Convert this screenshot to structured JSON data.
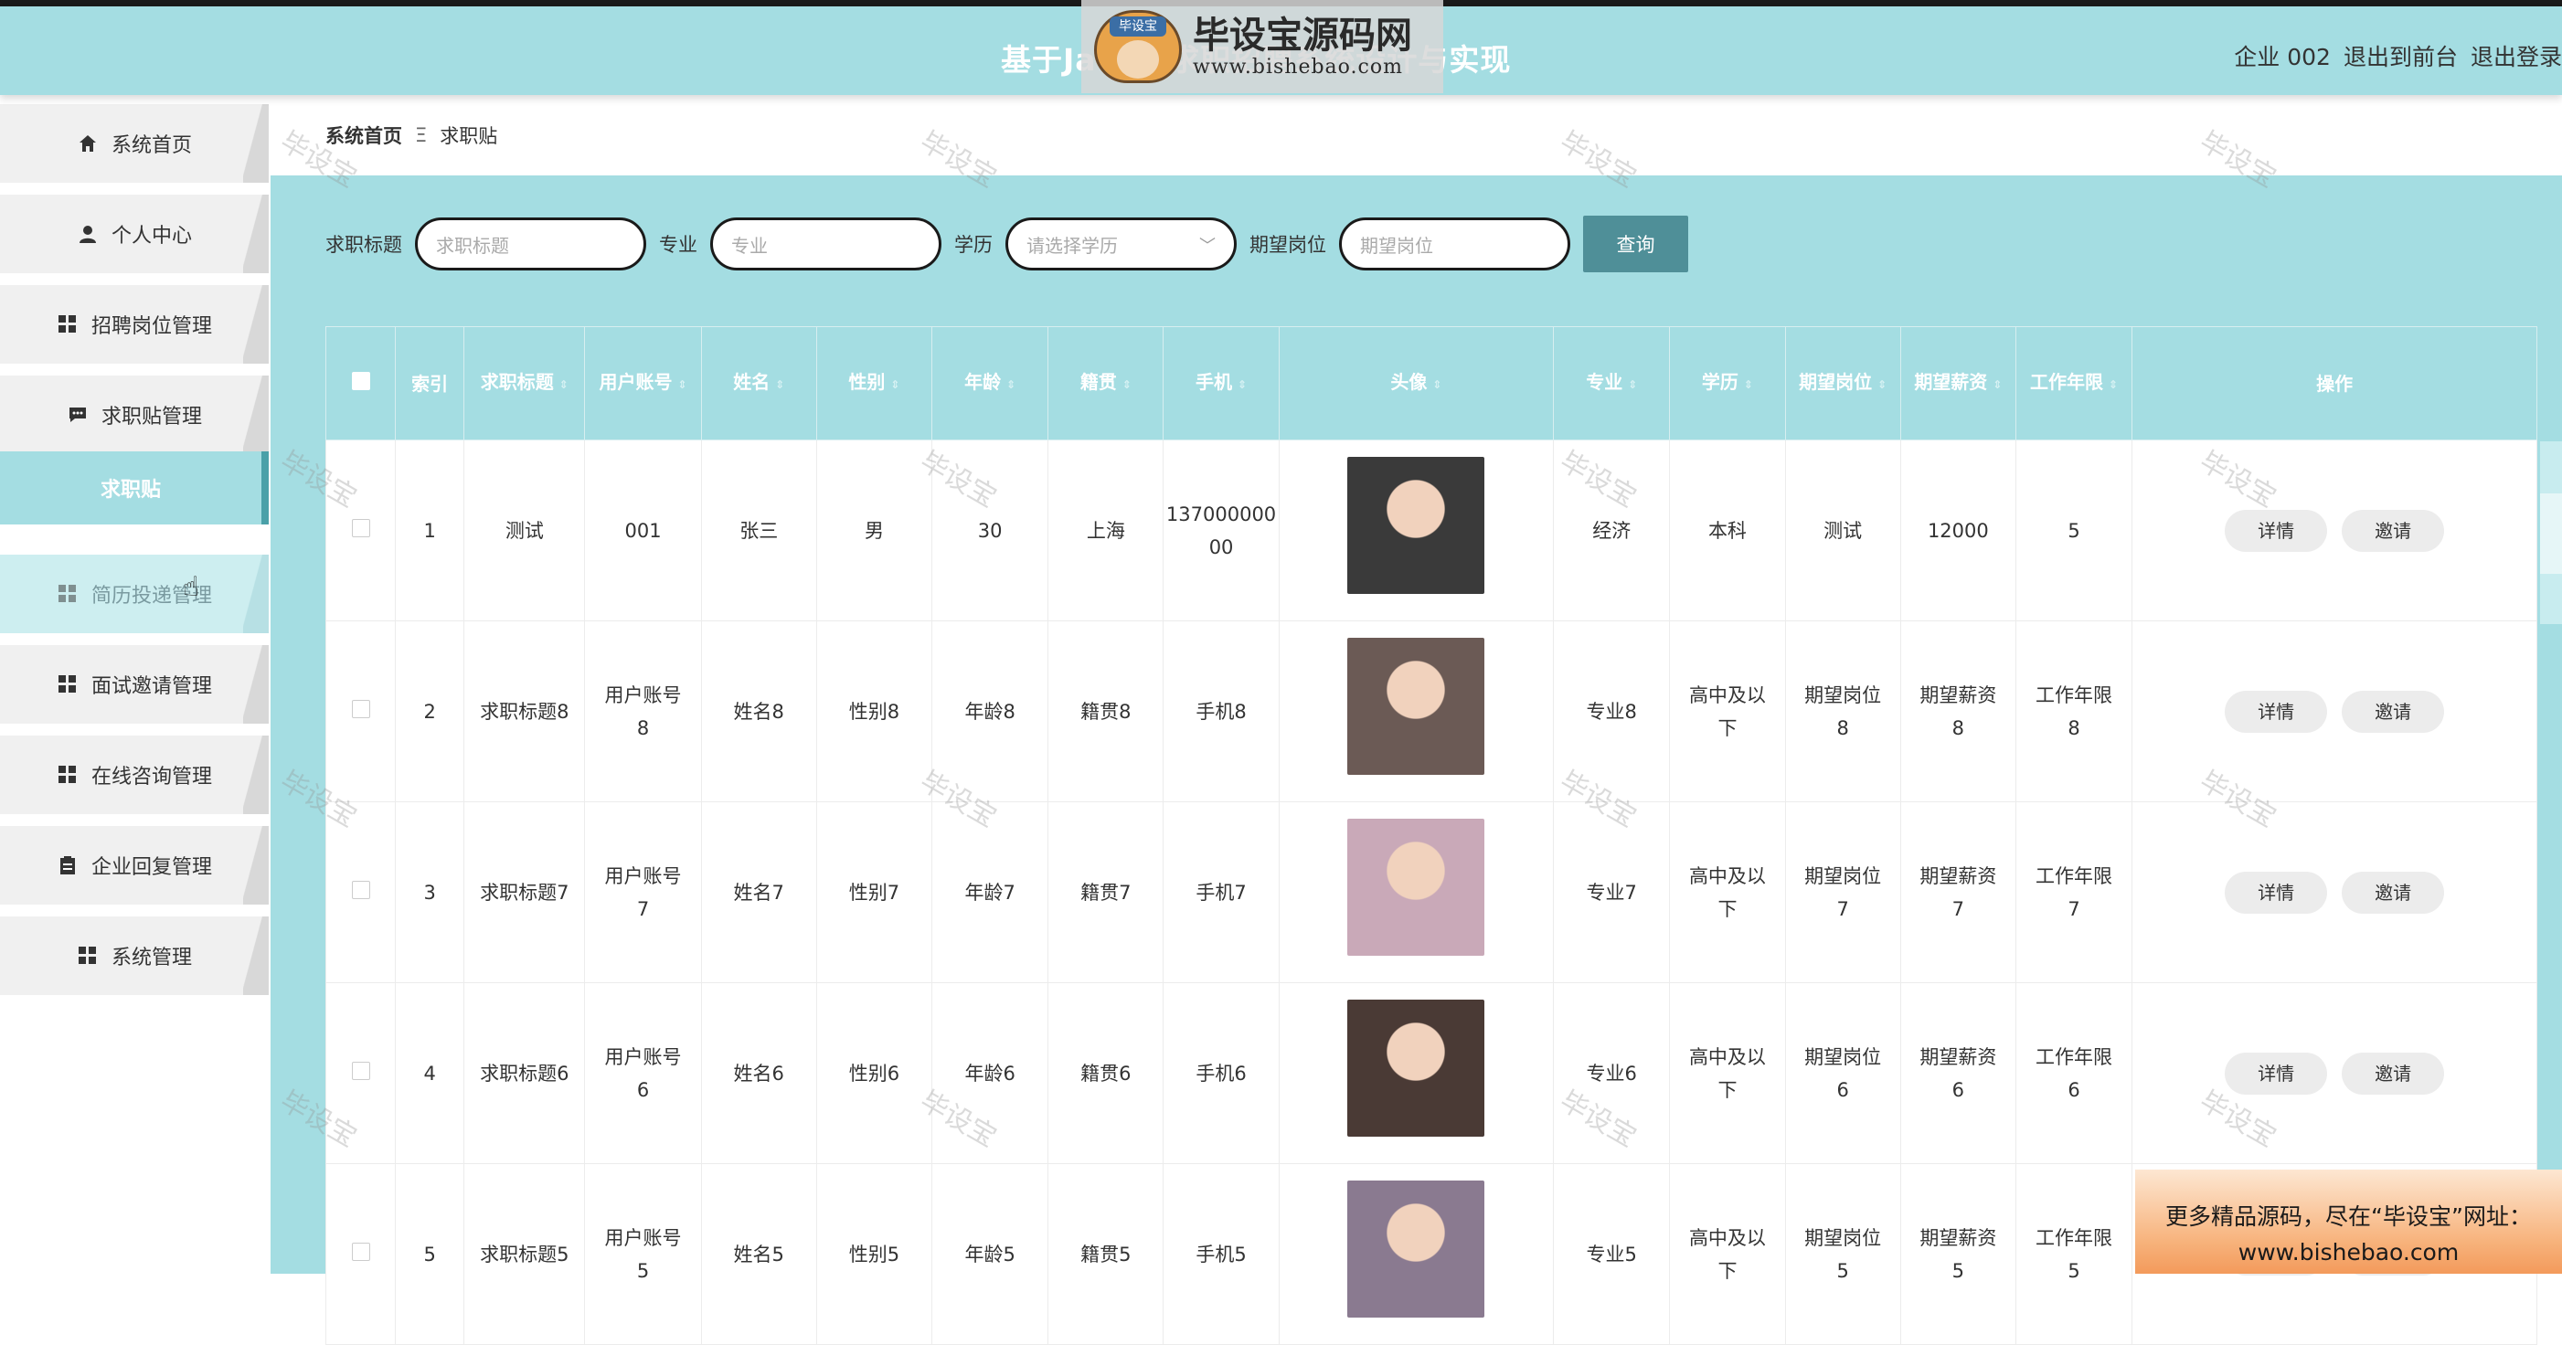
{
  "header": {
    "title": "基于Java的求职招聘系统设计与实现",
    "right": [
      "企业 002",
      "退出到前台",
      "退出登录"
    ]
  },
  "logo": {
    "main": "毕设宝源码网",
    "url": "www.bishebao.com",
    "badge": "毕设宝"
  },
  "sidebar": {
    "items": [
      {
        "label": "系统首页",
        "icon": "home-icon"
      },
      {
        "label": "个人中心",
        "icon": "user-icon"
      },
      {
        "label": "招聘岗位管理",
        "icon": "grid-icon"
      },
      {
        "label": "求职贴管理",
        "icon": "chat-icon"
      },
      {
        "label": "求职贴",
        "icon": ""
      },
      {
        "label": "简历投递管理",
        "icon": "grid-icon"
      },
      {
        "label": "面试邀请管理",
        "icon": "grid-icon"
      },
      {
        "label": "在线咨询管理",
        "icon": "grid-icon"
      },
      {
        "label": "企业回复管理",
        "icon": "clipboard-icon"
      },
      {
        "label": "系统管理",
        "icon": "grid-icon"
      }
    ]
  },
  "breadcrumb": {
    "home": "系统首页",
    "separator": "Ξ",
    "current": "求职贴"
  },
  "search": {
    "fields": [
      {
        "label": "求职标题",
        "placeholder": "求职标题"
      },
      {
        "label": "专业",
        "placeholder": "专业"
      },
      {
        "label": "学历",
        "placeholder": "请选择学历"
      },
      {
        "label": "期望岗位",
        "placeholder": "期望岗位"
      }
    ],
    "button": "查询"
  },
  "table": {
    "columns": [
      "",
      "索引",
      "求职标题",
      "用户账号",
      "姓名",
      "性别",
      "年龄",
      "籍贯",
      "手机",
      "头像",
      "专业",
      "学历",
      "期望岗位",
      "期望薪资",
      "工作年限",
      "操作"
    ],
    "rows": [
      {
        "idx": "1",
        "title": "测试",
        "account": "001",
        "name": "张三",
        "gender": "男",
        "age": "30",
        "origin": "上海",
        "phone": "13700000000",
        "major": "经济",
        "edu": "本科",
        "position": "测试",
        "salary": "12000",
        "years": "5",
        "avatar_color": "#3a3a3a"
      },
      {
        "idx": "2",
        "title": "求职标题8",
        "account": "用户账号8",
        "name": "姓名8",
        "gender": "性别8",
        "age": "年龄8",
        "origin": "籍贯8",
        "phone": "手机8",
        "major": "专业8",
        "edu": "高中及以下",
        "position": "期望岗位8",
        "salary": "期望薪资8",
        "years": "工作年限8",
        "avatar_color": "#6b5a55"
      },
      {
        "idx": "3",
        "title": "求职标题7",
        "account": "用户账号7",
        "name": "姓名7",
        "gender": "性别7",
        "age": "年龄7",
        "origin": "籍贯7",
        "phone": "手机7",
        "major": "专业7",
        "edu": "高中及以下",
        "position": "期望岗位7",
        "salary": "期望薪资7",
        "years": "工作年限7",
        "avatar_color": "#c9a9b8"
      },
      {
        "idx": "4",
        "title": "求职标题6",
        "account": "用户账号6",
        "name": "姓名6",
        "gender": "性别6",
        "age": "年龄6",
        "origin": "籍贯6",
        "phone": "手机6",
        "major": "专业6",
        "edu": "高中及以下",
        "position": "期望岗位6",
        "salary": "期望薪资6",
        "years": "工作年限6",
        "avatar_color": "#4a3a35"
      },
      {
        "idx": "5",
        "title": "求职标题5",
        "account": "用户账号5",
        "name": "姓名5",
        "gender": "性别5",
        "age": "年龄5",
        "origin": "籍贯5",
        "phone": "手机5",
        "major": "专业5",
        "edu": "高中及以下",
        "position": "期望岗位5",
        "salary": "期望薪资5",
        "years": "工作年限5",
        "avatar_color": "#8a7a90"
      }
    ],
    "actions": {
      "detail": "详情",
      "invite": "邀请"
    }
  },
  "watermark": "毕设宝",
  "ad": {
    "line1": "更多精品源码，尽在“毕设宝”网址：",
    "line2": "www.bishebao.com"
  },
  "colors": {
    "theme": "#a4dde2",
    "button": "#4f8f98"
  }
}
